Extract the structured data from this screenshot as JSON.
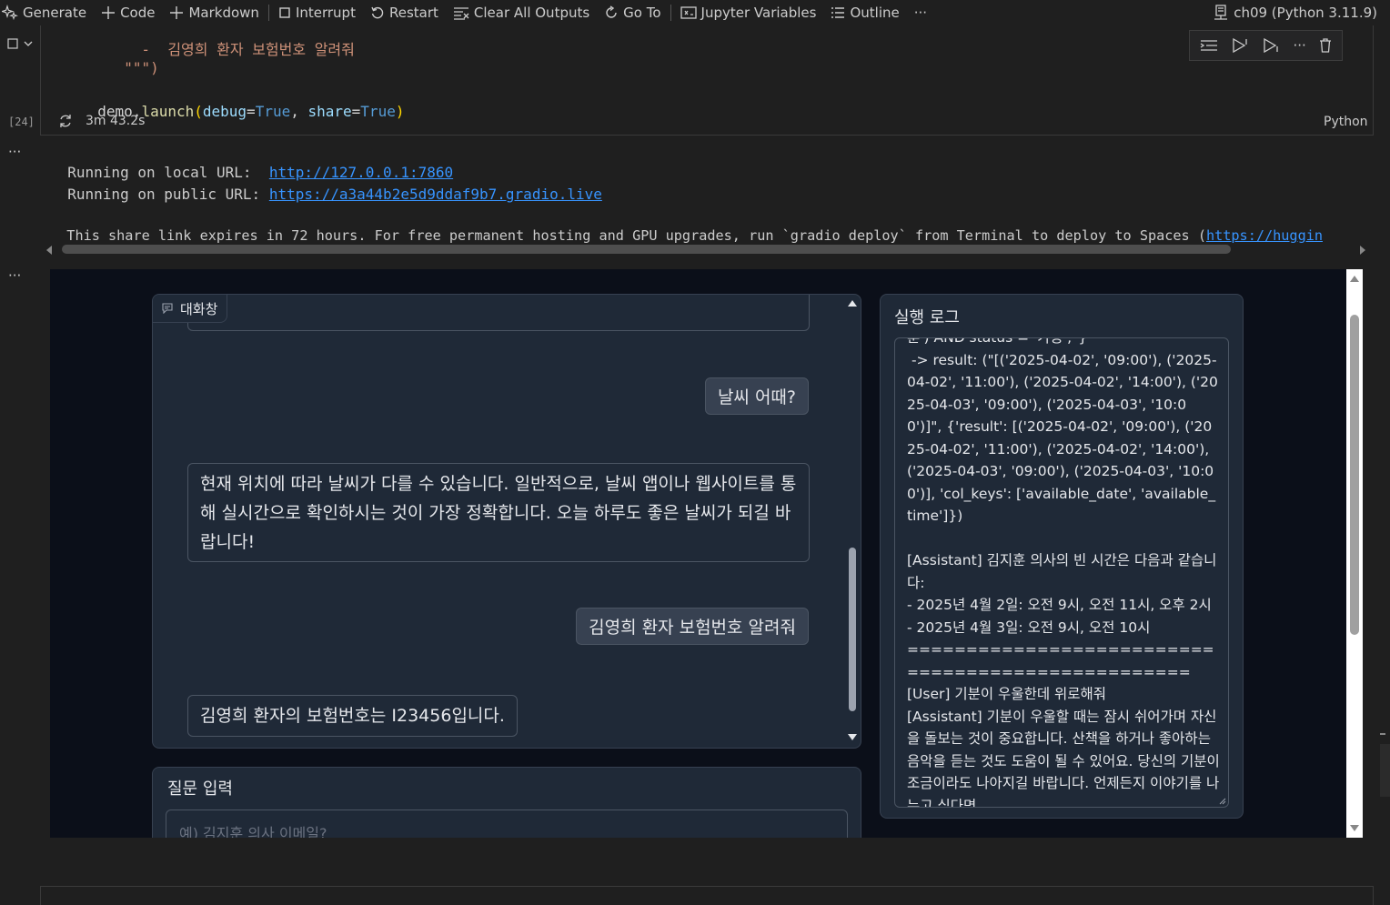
{
  "toolbar": {
    "generate": "Generate",
    "code": "Code",
    "markdown": "Markdown",
    "interrupt": "Interrupt",
    "restart": "Restart",
    "clear_outputs": "Clear All Outputs",
    "go_to": "Go To",
    "jupyter_variables": "Jupyter Variables",
    "outline": "Outline",
    "more": "···",
    "kernel": "ch09 (Python 3.11.9)"
  },
  "cell": {
    "line1_prefix": "     -  ",
    "line1_text": "김영희 환자 보험번호 알려줘",
    "line2": "\"\"\")",
    "launch_obj": "demo",
    "launch_fn": "launch",
    "launch_arg1": "debug",
    "launch_arg2": "share",
    "true_kw": "True",
    "exec_count": "[24]",
    "exec_time": "3m 43.2s",
    "language": "Python"
  },
  "output": {
    "local_label": "Running on local URL:  ",
    "local_url": "http://127.0.0.1:7860",
    "public_label": "Running on public URL: ",
    "public_url": "https://a3a44b2e5d9ddaf9b7.gradio.live",
    "share_text": "This share link expires in 72 hours. For free permanent hosting and GPU upgrades, run `gradio deploy` from Terminal to deploy to Spaces (",
    "share_link": "https://huggin"
  },
  "gradio": {
    "chat_label": "대화창",
    "messages": [
      {
        "role": "user",
        "text": "날씨 어때?"
      },
      {
        "role": "bot",
        "text": "현재 위치에 따라 날씨가 다를 수 있습니다. 일반적으로, 날씨 앱이나 웹사이트를 통해 실시간으로 확인하시는 것이 가장 정확합니다. 오늘 하루도 좋은 날씨가 되길 바랍니다!"
      },
      {
        "role": "user",
        "text": "김영희 환자 보험번호 알려줘"
      },
      {
        "role": "bot",
        "text": "김영희 환자의 보험번호는 I23456입니다."
      }
    ],
    "input_label": "질문 입력",
    "input_placeholder": "예) 김지훈 의사 이메일?",
    "log_label": "실행 로그",
    "log_text": "훈') AND status = '가능';\"}\n -> result: (\"[('2025-04-02', '09:00'), ('2025-04-02', '11:00'), ('2025-04-02', '14:00'), ('2025-04-03', '09:00'), ('2025-04-03', '10:00')]\", {'result': [('2025-04-02', '09:00'), ('2025-04-02', '11:00'), ('2025-04-02', '14:00'), ('2025-04-03', '09:00'), ('2025-04-03', '10:00')], 'col_keys': ['available_date', 'available_time']})\n\n[Assistant] 김지훈 의사의 빈 시간은 다음과 같습니다:\n- 2025년 4월 2일: 오전 9시, 오전 11시, 오후 2시\n- 2025년 4월 3일: 오전 9시, 오전 10시\n==================================================\n[User] 기분이 우울한데 위로해줘\n[Assistant] 기분이 우울할 때는 잠시 쉬어가며 자신을 돌보는 것이 중요합니다. 산책을 하거나 좋아하는 음악을 듣는 것도 도움이 될 수 있어요. 당신의 기분이 조금이라도 나아지길 바랍니다. 언제든지 이야기를 나누고 싶다면"
  },
  "colors": {
    "accent": "#3794ff",
    "gradio_bg": "#0b0f19",
    "panel_bg": "#1f2937"
  }
}
